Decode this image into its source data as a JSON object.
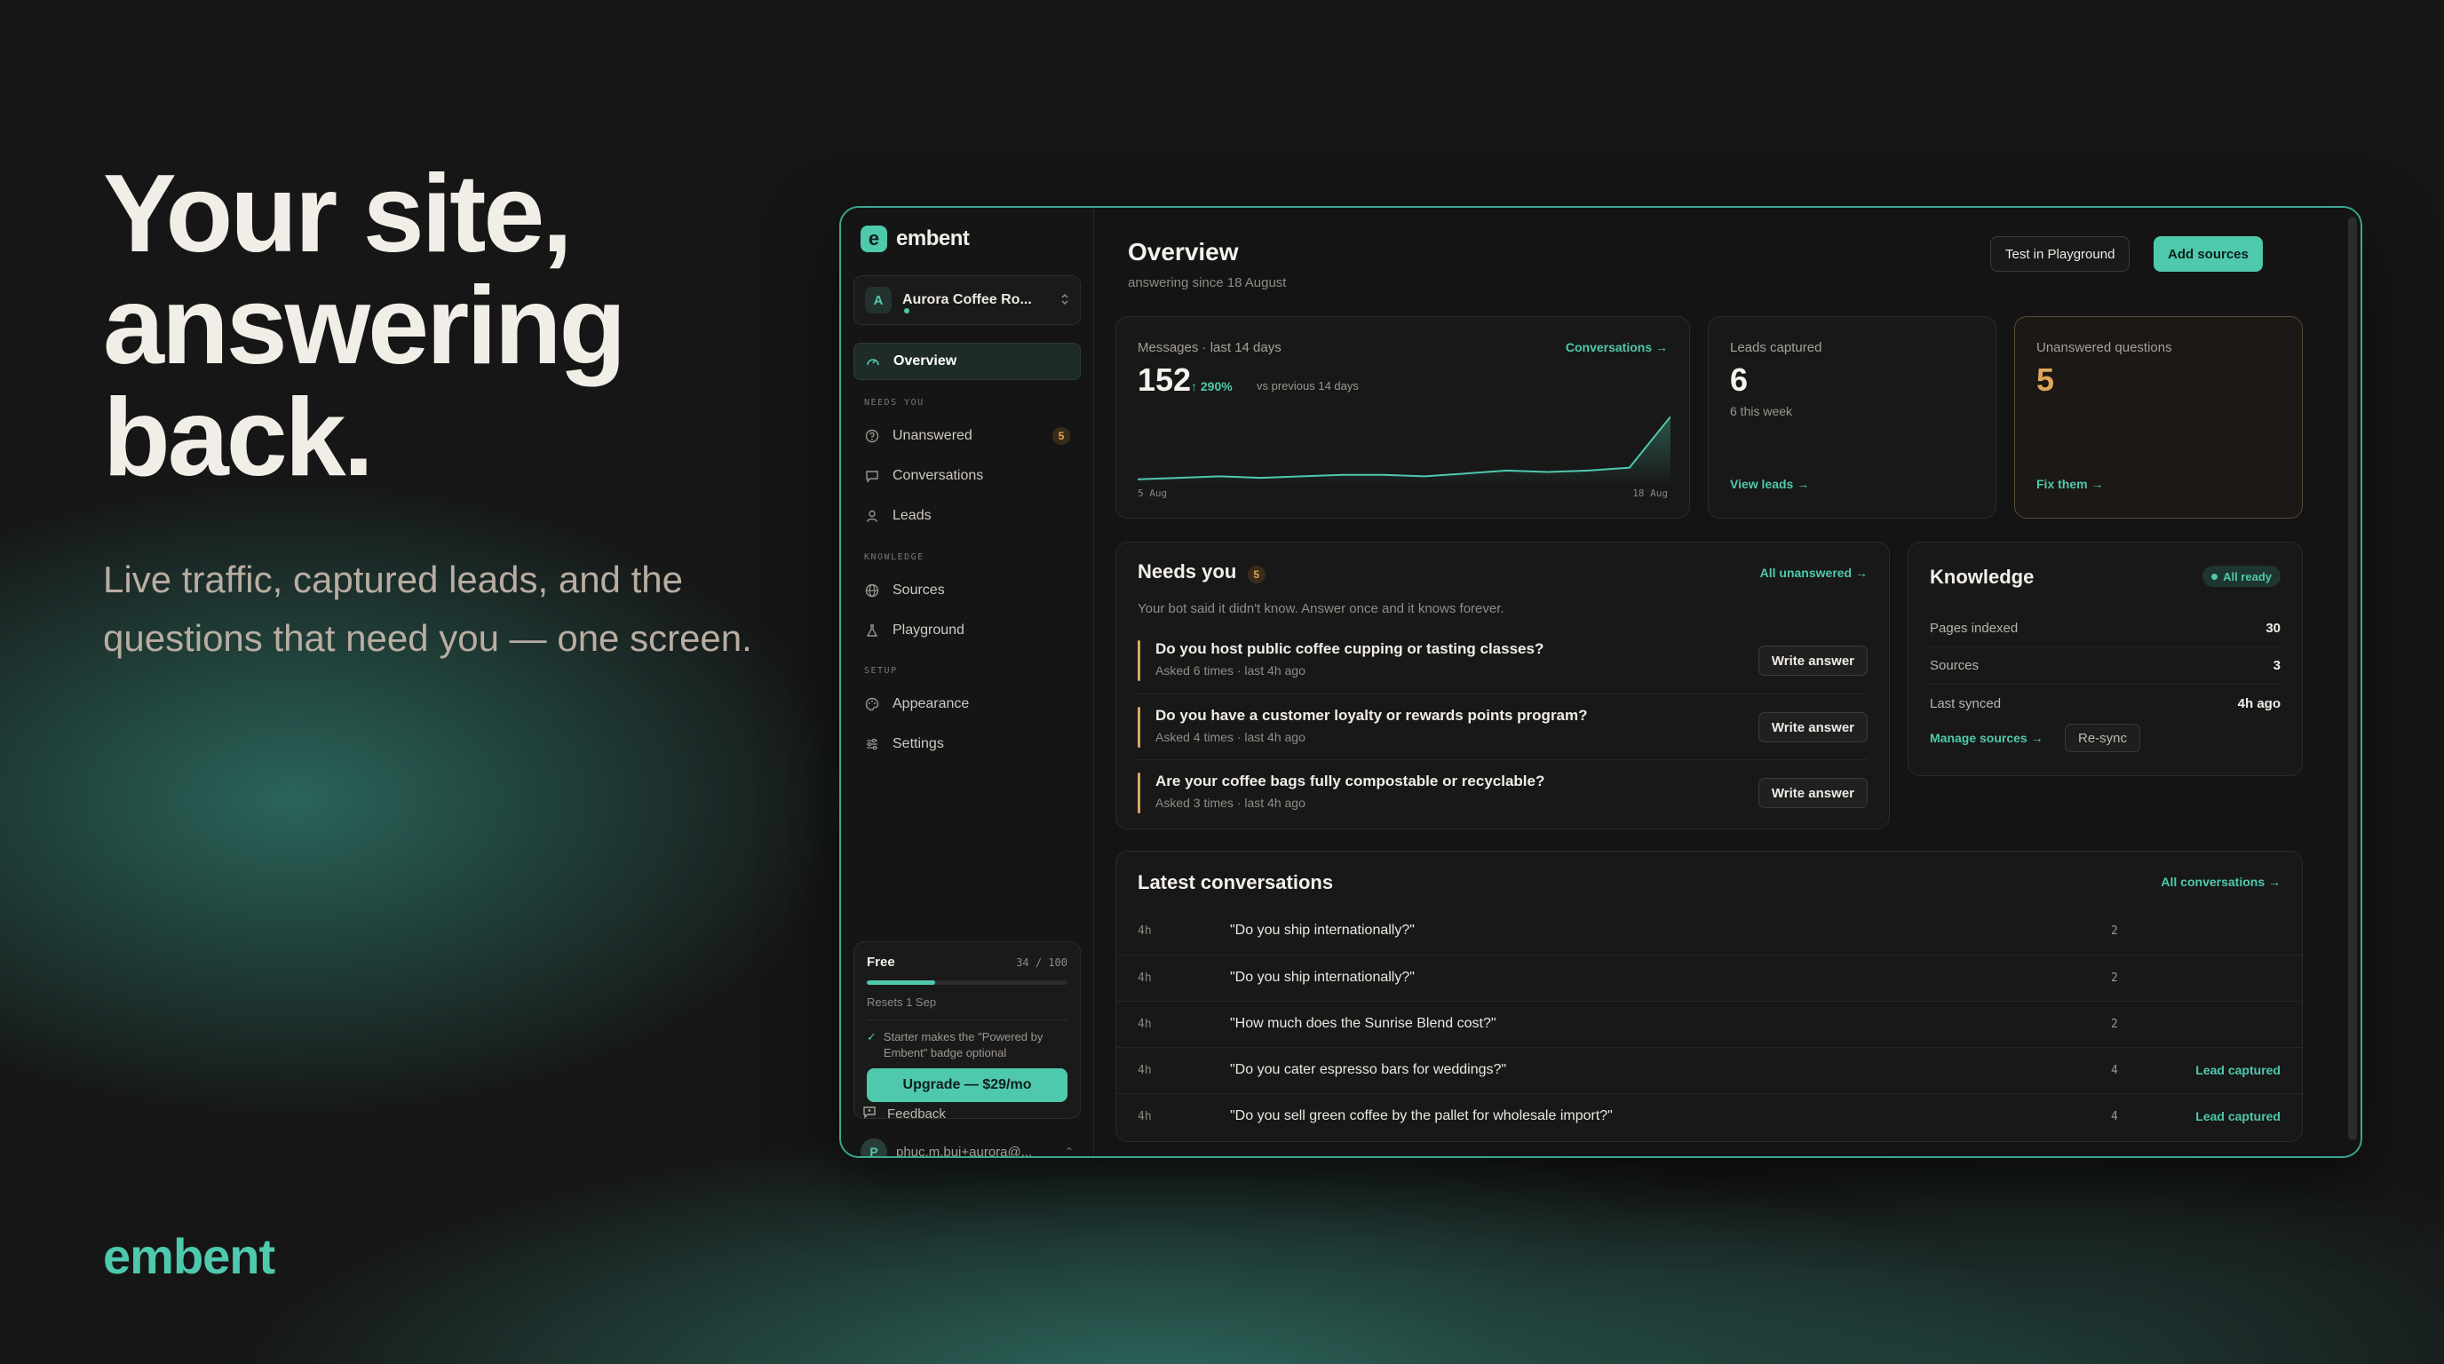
{
  "hero": {
    "title_lines": [
      "Your site,",
      "answering",
      "back."
    ],
    "subtitle": "Live traffic, captured leads, and the questions that need you — one screen.",
    "brand": "embent"
  },
  "app": {
    "logo_text": "embent",
    "logo_mark": "e",
    "workspace": {
      "avatar": "A",
      "name": "Aurora Coffee Ro...",
      "chevron": "⌃⌄"
    },
    "nav": {
      "overview": "Overview",
      "section_needs_you": "NEEDS YOU",
      "unanswered": "Unanswered",
      "unanswered_badge": "5",
      "conversations": "Conversations",
      "leads": "Leads",
      "section_knowledge": "KNOWLEDGE",
      "sources": "Sources",
      "playground": "Playground",
      "section_setup": "SETUP",
      "appearance": "Appearance",
      "settings": "Settings",
      "feedback": "Feedback"
    },
    "plan": {
      "name": "Free",
      "usage": "34 / 100",
      "usage_fraction": 0.34,
      "reset": "Resets 1 Sep",
      "note": "Starter makes the \"Powered by Embent\" badge optional",
      "upgrade_label": "Upgrade — $29/mo"
    },
    "user": {
      "avatar": "P",
      "email": "phuc.m.bui+aurora@..."
    }
  },
  "overview": {
    "title": "Overview",
    "subtitle": "answering since 18 August",
    "test_button": "Test in Playground",
    "add_button": "Add sources",
    "messages_card": {
      "label": "Messages · last 14 days",
      "link": "Conversations →",
      "value": "152",
      "trend": "↑ 290%",
      "trend_note": "vs previous 14 days",
      "x_start": "5 Aug",
      "x_end": "18 Aug"
    },
    "leads_card": {
      "label": "Leads captured",
      "value": "6",
      "sub": "6 this week",
      "link": "View leads →"
    },
    "unanswered_card": {
      "label": "Unanswered questions",
      "value": "5",
      "link": "Fix them →"
    }
  },
  "chart_data": {
    "type": "area",
    "title": "",
    "x": [
      "5 Aug",
      "6 Aug",
      "7 Aug",
      "8 Aug",
      "9 Aug",
      "10 Aug",
      "11 Aug",
      "12 Aug",
      "13 Aug",
      "14 Aug",
      "15 Aug",
      "16 Aug",
      "17 Aug",
      "18 Aug"
    ],
    "values": [
      2,
      3,
      4,
      3,
      4,
      5,
      5,
      4,
      6,
      8,
      7,
      8,
      10,
      45
    ],
    "ylim": [
      0,
      50
    ],
    "xlabel": "",
    "ylabel": ""
  },
  "needs_you": {
    "title": "Needs you",
    "count": "5",
    "link": "All unanswered →",
    "description": "Your bot said it didn't know. Answer once and it knows forever.",
    "write_label": "Write answer",
    "questions": [
      {
        "text": "Do you host public coffee cupping or tasting classes?",
        "meta": "Asked 6 times · last 4h ago"
      },
      {
        "text": "Do you have a customer loyalty or rewards points program?",
        "meta": "Asked 4 times · last 4h ago"
      },
      {
        "text": "Are your coffee bags fully compostable or recyclable?",
        "meta": "Asked 3 times · last 4h ago"
      }
    ]
  },
  "knowledge": {
    "title": "Knowledge",
    "status": "All ready",
    "pages_label": "Pages indexed",
    "pages_value": "30",
    "sources_label": "Sources",
    "sources_value": "3",
    "synced_label": "Last synced",
    "synced_value": "4h ago",
    "manage_link": "Manage sources →",
    "resync_label": "Re-sync"
  },
  "latest": {
    "title": "Latest conversations",
    "link": "All conversations →",
    "rows": [
      {
        "time": "4h",
        "text": "\"Do you ship internationally?\"",
        "count": "2",
        "lead": ""
      },
      {
        "time": "4h",
        "text": "\"Do you ship internationally?\"",
        "count": "2",
        "lead": ""
      },
      {
        "time": "4h",
        "text": "\"How much does the Sunrise Blend cost?\"",
        "count": "2",
        "lead": ""
      },
      {
        "time": "4h",
        "text": "\"Do you cater espresso bars for weddings?\"",
        "count": "4",
        "lead": "Lead captured"
      },
      {
        "time": "4h",
        "text": "\"Do you sell green coffee by the pallet for wholesale import?\"",
        "count": "4",
        "lead": "Lead captured"
      }
    ]
  },
  "colors": {
    "accent": "#4fc9ad",
    "warning": "#e0a55a",
    "background": "#161616"
  }
}
